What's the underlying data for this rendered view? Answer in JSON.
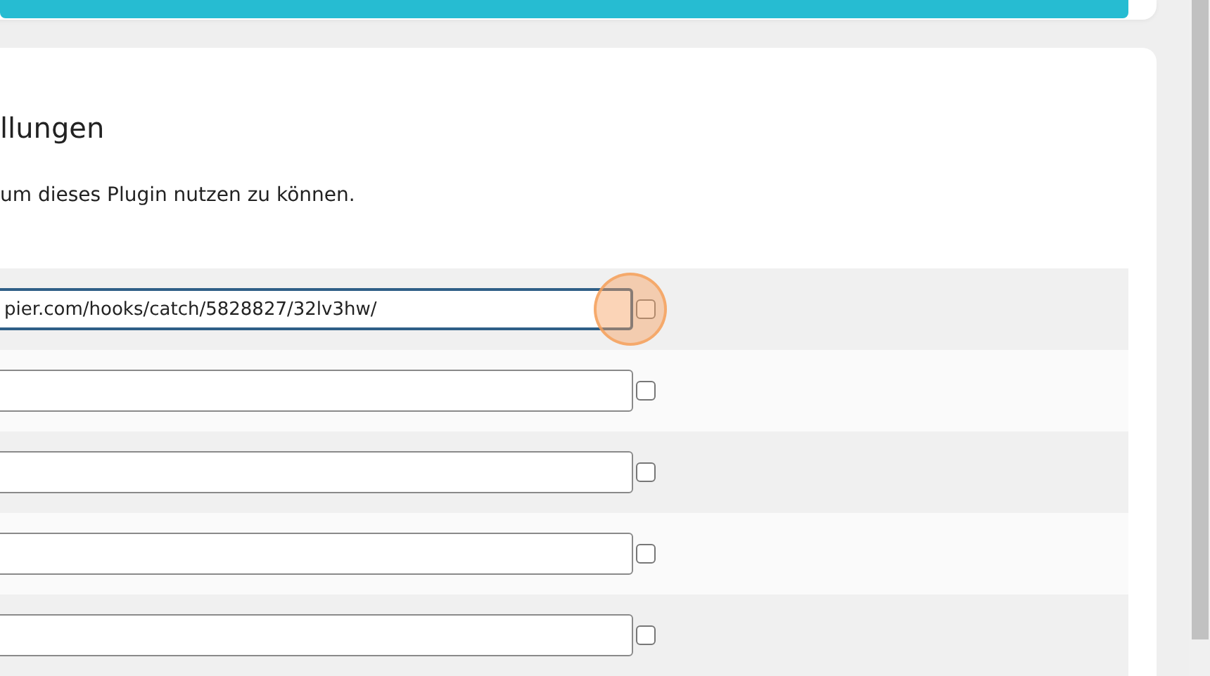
{
  "heading": "llungen",
  "description": "um dieses Plugin nutzen zu können.",
  "rows": [
    {
      "value": "pier.com/hooks/catch/5828827/32lv3hw/",
      "focused": true,
      "checked": false
    },
    {
      "value": "",
      "focused": false,
      "checked": false
    },
    {
      "value": "",
      "focused": false,
      "checked": false
    },
    {
      "value": "",
      "focused": false,
      "checked": false
    },
    {
      "value": "",
      "focused": false,
      "checked": false
    }
  ]
}
